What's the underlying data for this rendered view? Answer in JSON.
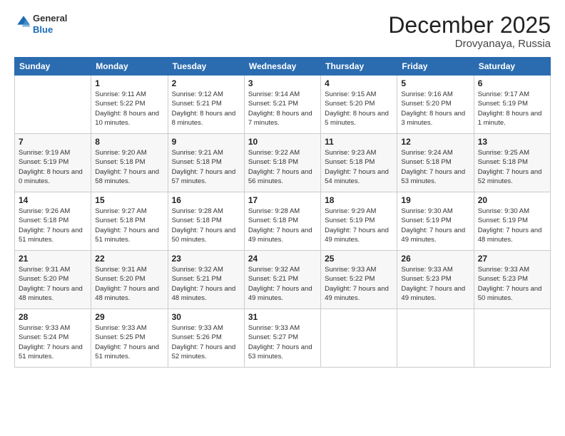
{
  "logo": {
    "general": "General",
    "blue": "Blue"
  },
  "title": "December 2025",
  "subtitle": "Drovyanaya, Russia",
  "days_header": [
    "Sunday",
    "Monday",
    "Tuesday",
    "Wednesday",
    "Thursday",
    "Friday",
    "Saturday"
  ],
  "weeks": [
    [
      {
        "day": "",
        "sunrise": "",
        "sunset": "",
        "daylight": ""
      },
      {
        "day": "1",
        "sunrise": "Sunrise: 9:11 AM",
        "sunset": "Sunset: 5:22 PM",
        "daylight": "Daylight: 8 hours and 10 minutes."
      },
      {
        "day": "2",
        "sunrise": "Sunrise: 9:12 AM",
        "sunset": "Sunset: 5:21 PM",
        "daylight": "Daylight: 8 hours and 8 minutes."
      },
      {
        "day": "3",
        "sunrise": "Sunrise: 9:14 AM",
        "sunset": "Sunset: 5:21 PM",
        "daylight": "Daylight: 8 hours and 7 minutes."
      },
      {
        "day": "4",
        "sunrise": "Sunrise: 9:15 AM",
        "sunset": "Sunset: 5:20 PM",
        "daylight": "Daylight: 8 hours and 5 minutes."
      },
      {
        "day": "5",
        "sunrise": "Sunrise: 9:16 AM",
        "sunset": "Sunset: 5:20 PM",
        "daylight": "Daylight: 8 hours and 3 minutes."
      },
      {
        "day": "6",
        "sunrise": "Sunrise: 9:17 AM",
        "sunset": "Sunset: 5:19 PM",
        "daylight": "Daylight: 8 hours and 1 minute."
      }
    ],
    [
      {
        "day": "7",
        "sunrise": "Sunrise: 9:19 AM",
        "sunset": "Sunset: 5:19 PM",
        "daylight": "Daylight: 8 hours and 0 minutes."
      },
      {
        "day": "8",
        "sunrise": "Sunrise: 9:20 AM",
        "sunset": "Sunset: 5:18 PM",
        "daylight": "Daylight: 7 hours and 58 minutes."
      },
      {
        "day": "9",
        "sunrise": "Sunrise: 9:21 AM",
        "sunset": "Sunset: 5:18 PM",
        "daylight": "Daylight: 7 hours and 57 minutes."
      },
      {
        "day": "10",
        "sunrise": "Sunrise: 9:22 AM",
        "sunset": "Sunset: 5:18 PM",
        "daylight": "Daylight: 7 hours and 56 minutes."
      },
      {
        "day": "11",
        "sunrise": "Sunrise: 9:23 AM",
        "sunset": "Sunset: 5:18 PM",
        "daylight": "Daylight: 7 hours and 54 minutes."
      },
      {
        "day": "12",
        "sunrise": "Sunrise: 9:24 AM",
        "sunset": "Sunset: 5:18 PM",
        "daylight": "Daylight: 7 hours and 53 minutes."
      },
      {
        "day": "13",
        "sunrise": "Sunrise: 9:25 AM",
        "sunset": "Sunset: 5:18 PM",
        "daylight": "Daylight: 7 hours and 52 minutes."
      }
    ],
    [
      {
        "day": "14",
        "sunrise": "Sunrise: 9:26 AM",
        "sunset": "Sunset: 5:18 PM",
        "daylight": "Daylight: 7 hours and 51 minutes."
      },
      {
        "day": "15",
        "sunrise": "Sunrise: 9:27 AM",
        "sunset": "Sunset: 5:18 PM",
        "daylight": "Daylight: 7 hours and 51 minutes."
      },
      {
        "day": "16",
        "sunrise": "Sunrise: 9:28 AM",
        "sunset": "Sunset: 5:18 PM",
        "daylight": "Daylight: 7 hours and 50 minutes."
      },
      {
        "day": "17",
        "sunrise": "Sunrise: 9:28 AM",
        "sunset": "Sunset: 5:18 PM",
        "daylight": "Daylight: 7 hours and 49 minutes."
      },
      {
        "day": "18",
        "sunrise": "Sunrise: 9:29 AM",
        "sunset": "Sunset: 5:19 PM",
        "daylight": "Daylight: 7 hours and 49 minutes."
      },
      {
        "day": "19",
        "sunrise": "Sunrise: 9:30 AM",
        "sunset": "Sunset: 5:19 PM",
        "daylight": "Daylight: 7 hours and 49 minutes."
      },
      {
        "day": "20",
        "sunrise": "Sunrise: 9:30 AM",
        "sunset": "Sunset: 5:19 PM",
        "daylight": "Daylight: 7 hours and 48 minutes."
      }
    ],
    [
      {
        "day": "21",
        "sunrise": "Sunrise: 9:31 AM",
        "sunset": "Sunset: 5:20 PM",
        "daylight": "Daylight: 7 hours and 48 minutes."
      },
      {
        "day": "22",
        "sunrise": "Sunrise: 9:31 AM",
        "sunset": "Sunset: 5:20 PM",
        "daylight": "Daylight: 7 hours and 48 minutes."
      },
      {
        "day": "23",
        "sunrise": "Sunrise: 9:32 AM",
        "sunset": "Sunset: 5:21 PM",
        "daylight": "Daylight: 7 hours and 48 minutes."
      },
      {
        "day": "24",
        "sunrise": "Sunrise: 9:32 AM",
        "sunset": "Sunset: 5:21 PM",
        "daylight": "Daylight: 7 hours and 49 minutes."
      },
      {
        "day": "25",
        "sunrise": "Sunrise: 9:33 AM",
        "sunset": "Sunset: 5:22 PM",
        "daylight": "Daylight: 7 hours and 49 minutes."
      },
      {
        "day": "26",
        "sunrise": "Sunrise: 9:33 AM",
        "sunset": "Sunset: 5:23 PM",
        "daylight": "Daylight: 7 hours and 49 minutes."
      },
      {
        "day": "27",
        "sunrise": "Sunrise: 9:33 AM",
        "sunset": "Sunset: 5:23 PM",
        "daylight": "Daylight: 7 hours and 50 minutes."
      }
    ],
    [
      {
        "day": "28",
        "sunrise": "Sunrise: 9:33 AM",
        "sunset": "Sunset: 5:24 PM",
        "daylight": "Daylight: 7 hours and 51 minutes."
      },
      {
        "day": "29",
        "sunrise": "Sunrise: 9:33 AM",
        "sunset": "Sunset: 5:25 PM",
        "daylight": "Daylight: 7 hours and 51 minutes."
      },
      {
        "day": "30",
        "sunrise": "Sunrise: 9:33 AM",
        "sunset": "Sunset: 5:26 PM",
        "daylight": "Daylight: 7 hours and 52 minutes."
      },
      {
        "day": "31",
        "sunrise": "Sunrise: 9:33 AM",
        "sunset": "Sunset: 5:27 PM",
        "daylight": "Daylight: 7 hours and 53 minutes."
      },
      {
        "day": "",
        "sunrise": "",
        "sunset": "",
        "daylight": ""
      },
      {
        "day": "",
        "sunrise": "",
        "sunset": "",
        "daylight": ""
      },
      {
        "day": "",
        "sunrise": "",
        "sunset": "",
        "daylight": ""
      }
    ]
  ]
}
